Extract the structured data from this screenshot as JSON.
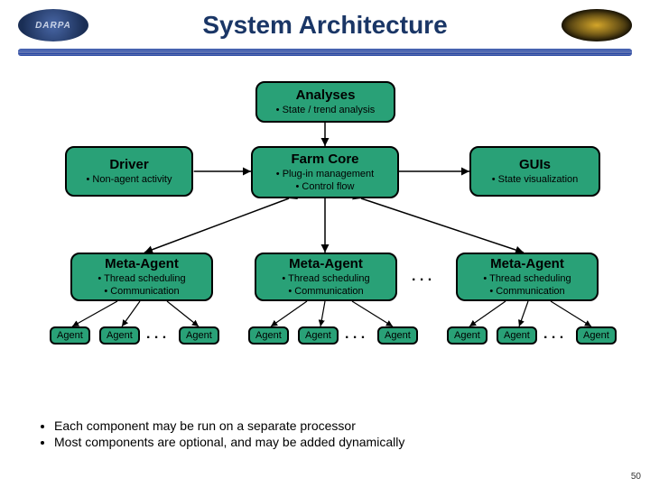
{
  "header": {
    "title": "System Architecture",
    "logo_left_text": "DARPA"
  },
  "nodes": {
    "analyses": {
      "title": "Analyses",
      "sub": "• State / trend analysis"
    },
    "driver": {
      "title": "Driver",
      "sub": "• Non-agent activity"
    },
    "farmcore": {
      "title": "Farm Core",
      "sub": "• Plug-in management\n• Control flow"
    },
    "guis": {
      "title": "GUIs",
      "sub": "• State visualization"
    },
    "meta1": {
      "title": "Meta-Agent",
      "sub": "• Thread scheduling\n• Communication"
    },
    "meta2": {
      "title": "Meta-Agent",
      "sub": "• Thread scheduling\n• Communication"
    },
    "meta3": {
      "title": "Meta-Agent",
      "sub": "• Thread scheduling\n• Communication"
    }
  },
  "agent_label": "Agent",
  "ellipsis": ". . .",
  "meta_ellipsis": ". . .",
  "bullets": [
    "Each component may be run on a separate processor",
    "Most components are optional, and may be added dynamically"
  ],
  "page_number": "50"
}
